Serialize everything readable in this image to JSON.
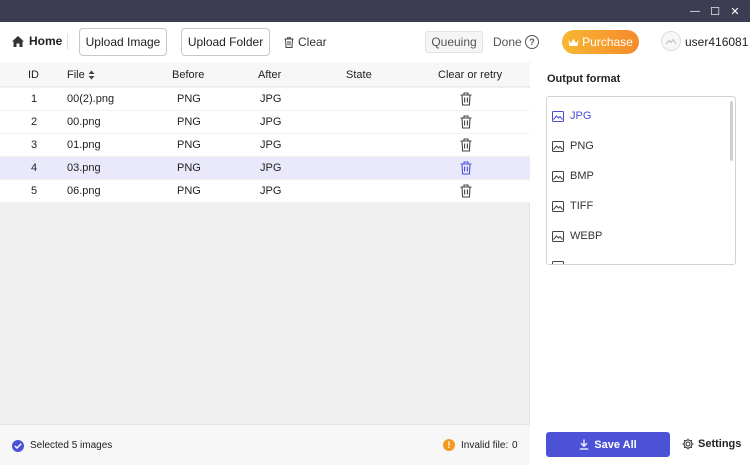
{
  "window": {
    "minimize_glyph": "—",
    "maximize_glyph": "☐",
    "close_glyph": "✕"
  },
  "toolbar": {
    "home_label": "Home",
    "upload_image_label": "Upload Image",
    "upload_folder_label": "Upload Folder",
    "clear_label": "Clear",
    "queuing_label": "Queuing",
    "done_label": "Done",
    "help_glyph": "?",
    "purchase_label": "Purchase",
    "username": "user416081"
  },
  "table": {
    "headers": {
      "id": "ID",
      "file": "File",
      "before": "Before",
      "after": "After",
      "state": "State",
      "action": "Clear or retry"
    },
    "rows": [
      {
        "id": "1",
        "file": "00(2).png",
        "before": "PNG",
        "after": "JPG",
        "state": ""
      },
      {
        "id": "2",
        "file": "00.png",
        "before": "PNG",
        "after": "JPG",
        "state": ""
      },
      {
        "id": "3",
        "file": "01.png",
        "before": "PNG",
        "after": "JPG",
        "state": ""
      },
      {
        "id": "4",
        "file": "03.png",
        "before": "PNG",
        "after": "JPG",
        "state": ""
      },
      {
        "id": "5",
        "file": "06.png",
        "before": "PNG",
        "after": "JPG",
        "state": ""
      }
    ]
  },
  "side": {
    "title": "Output format",
    "formats": [
      "JPG",
      "PNG",
      "BMP",
      "TIFF",
      "WEBP"
    ],
    "selected_format": "JPG"
  },
  "status": {
    "selected_text": "Selected 5 images",
    "invalid_label": "Invalid file:",
    "invalid_count": "0",
    "warn_glyph": "!"
  },
  "footer": {
    "save_all_label": "Save All",
    "settings_label": "Settings"
  },
  "colors": {
    "accent": "#4b52d6",
    "titlebar": "#3c3d52",
    "purchase_start": "#f7b733",
    "purchase_end": "#f58a2a",
    "selected_row": "#e9e9fb"
  }
}
